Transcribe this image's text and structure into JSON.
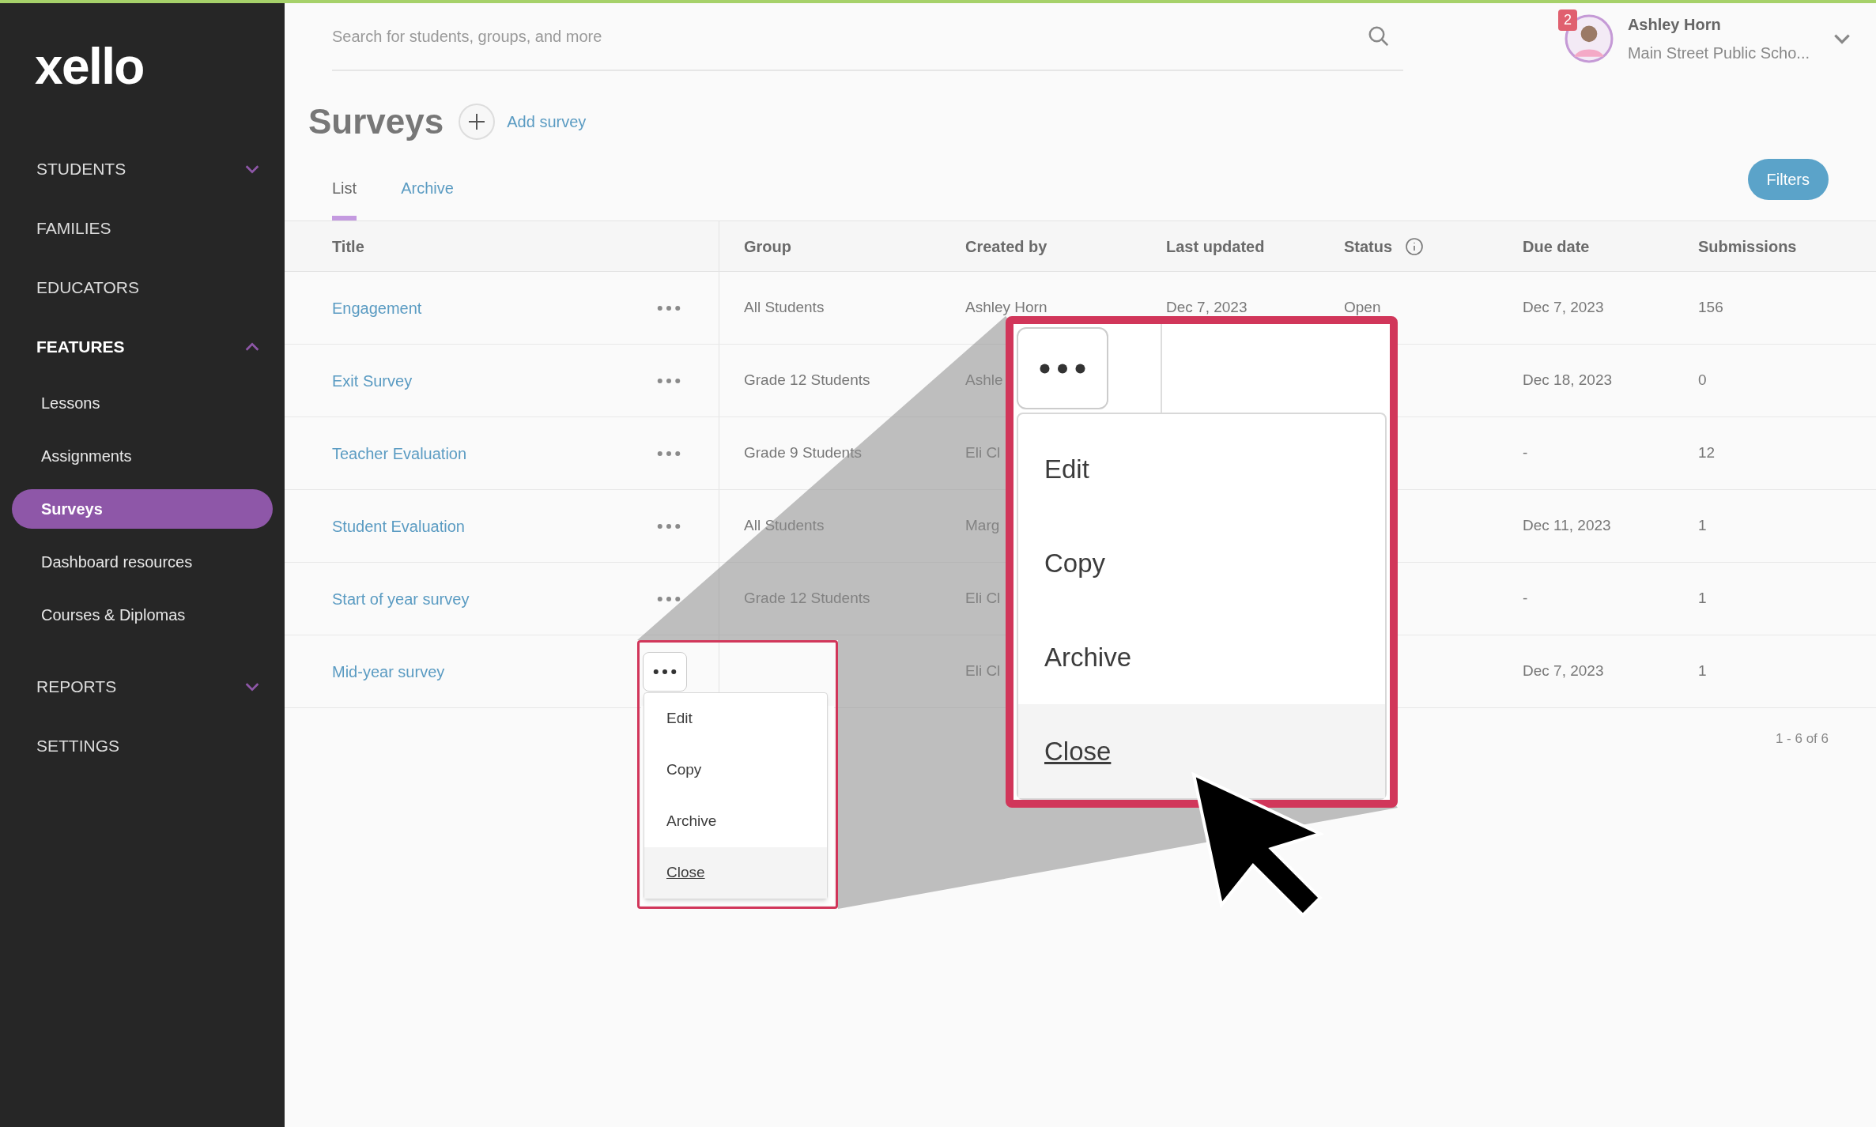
{
  "sidebar": {
    "logo": "xello",
    "items": [
      {
        "kind": "section",
        "label": "STUDENTS",
        "expanded": false
      },
      {
        "kind": "link",
        "label": "FAMILIES"
      },
      {
        "kind": "link",
        "label": "EDUCATORS"
      },
      {
        "kind": "section",
        "label": "FEATURES",
        "expanded": true,
        "children": [
          {
            "label": "Lessons",
            "selected": false
          },
          {
            "label": "Assignments",
            "selected": false
          },
          {
            "label": "Surveys",
            "selected": true
          },
          {
            "label": "Dashboard resources",
            "selected": false
          },
          {
            "label": "Courses & Diplomas",
            "selected": false
          }
        ]
      },
      {
        "kind": "section",
        "label": "REPORTS",
        "expanded": false
      },
      {
        "kind": "link",
        "label": "SETTINGS"
      }
    ]
  },
  "search": {
    "placeholder": "Search for students, groups, and more"
  },
  "user": {
    "name": "Ashley Horn",
    "school": "Main Street Public Scho...",
    "badge": "2"
  },
  "page": {
    "title": "Surveys",
    "add_label": "Add survey"
  },
  "tabs": [
    {
      "label": "List",
      "selected": true
    },
    {
      "label": "Archive",
      "selected": false
    }
  ],
  "filters_button": "Filters",
  "table": {
    "columns": [
      "Title",
      "Group",
      "Created by",
      "Last updated",
      "Status",
      "Due date",
      "Submissions"
    ],
    "rows": [
      {
        "title": "Engagement",
        "group": "All Students",
        "created_by": "Ashley Horn",
        "last_updated": "Dec 7, 2023",
        "status": "Open",
        "due_date": "Dec 7, 2023",
        "submissions": "156",
        "menu_open": false
      },
      {
        "title": "Exit Survey",
        "group": "Grade 12 Students",
        "created_by": "Ashle",
        "due_date": "Dec 18, 2023",
        "submissions": "0",
        "menu_open": false
      },
      {
        "title": "Teacher Evaluation",
        "group": "Grade 9 Students",
        "created_by": "Eli Cl",
        "due_date": "-",
        "submissions": "12",
        "menu_open": false
      },
      {
        "title": "Student Evaluation",
        "group": "All Students",
        "created_by": "Marg",
        "due_date": "Dec 11, 2023",
        "submissions": "1",
        "menu_open": false
      },
      {
        "title": "Start of year survey",
        "group": "Grade 12 Students",
        "created_by": "Eli Cl",
        "due_date": "-",
        "submissions": "1",
        "menu_open": false
      },
      {
        "title": "Mid-year survey",
        "created_by": "Eli Cl",
        "due_date": "Dec 7, 2023",
        "submissions": "1",
        "menu_open": true
      }
    ]
  },
  "pagination": "1 - 6 of 6",
  "row_menu": [
    {
      "label": "Edit",
      "highlighted": false
    },
    {
      "label": "Copy",
      "highlighted": false
    },
    {
      "label": "Archive",
      "highlighted": false
    },
    {
      "label": "Close",
      "highlighted": true
    }
  ],
  "magnified_menu": [
    {
      "label": "Edit",
      "highlighted": false
    },
    {
      "label": "Copy",
      "highlighted": false
    },
    {
      "label": "Archive",
      "highlighted": false
    },
    {
      "label": "Close",
      "highlighted": true
    }
  ]
}
